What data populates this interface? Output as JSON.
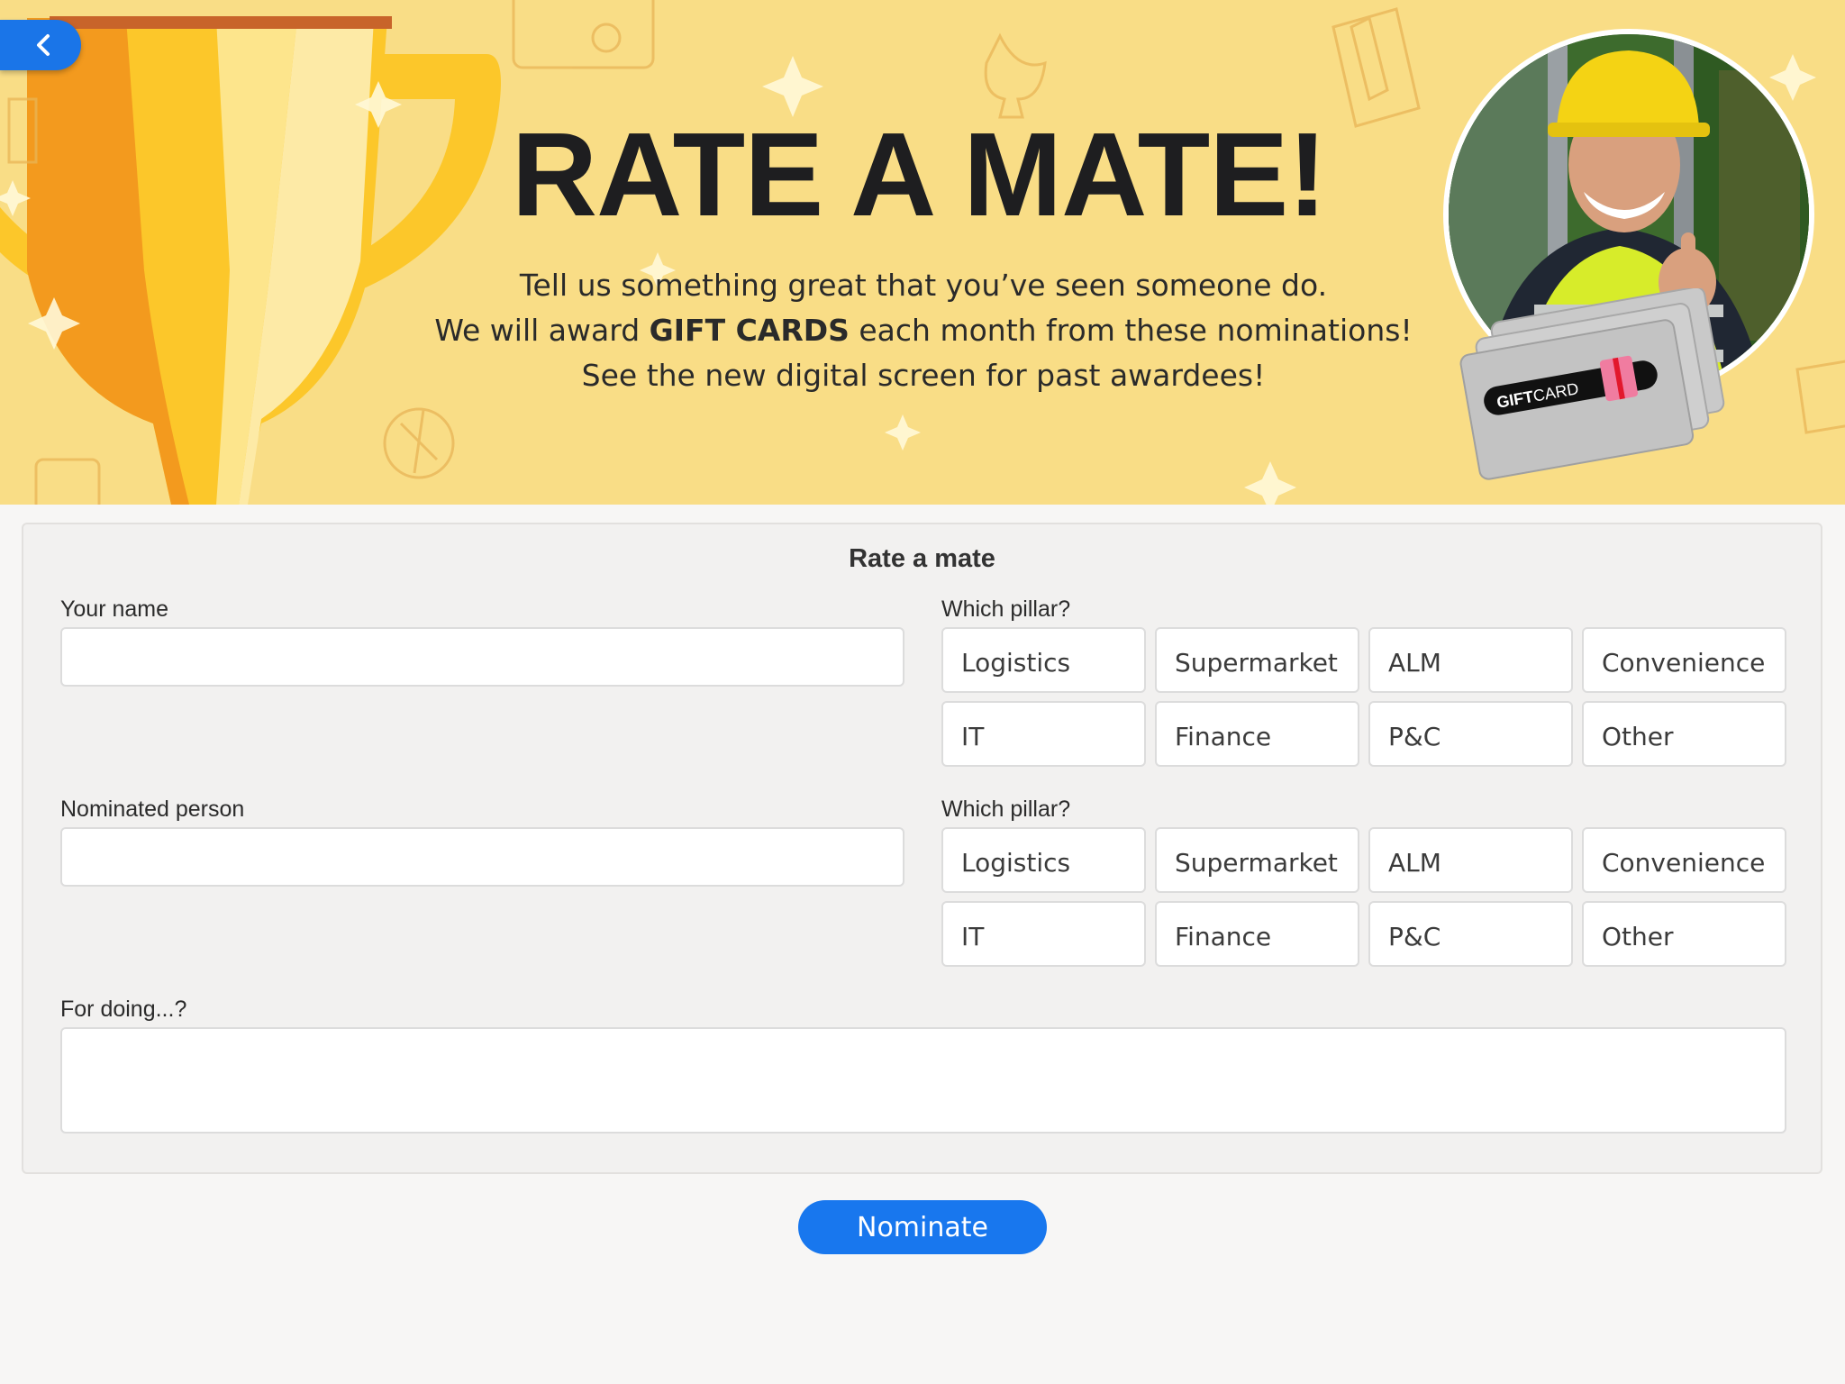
{
  "hero": {
    "title": "RATE A MATE!",
    "line1": "Tell us something great that you’ve seen someone do.",
    "line2_prefix": "We will award ",
    "line2_bold": "GIFT CARDS",
    "line2_suffix": " each month from these nominations!",
    "line3": "See the new digital screen for past awardees!",
    "giftcard_text_a": "GIFT",
    "giftcard_text_b": "CARD"
  },
  "colors": {
    "banner": "#f9dd86",
    "accent": "#1877ee",
    "trophy_orange": "#f39a1e",
    "trophy_yellow": "#fcc72a"
  },
  "form": {
    "title": "Rate a mate",
    "your_name_label": "Your name",
    "your_name_value": "",
    "pillar_label_1": "Which pillar?",
    "nominee_label": "Nominated person",
    "nominee_value": "",
    "pillar_label_2": "Which pillar?",
    "doing_label": "For doing...?",
    "doing_value": "",
    "pillars": [
      "Logistics",
      "Supermarket",
      "ALM",
      "Convenience",
      "IT",
      "Finance",
      "P&C",
      "Other"
    ]
  },
  "actions": {
    "nominate_label": "Nominate",
    "back_icon": "chevron-left-icon"
  }
}
